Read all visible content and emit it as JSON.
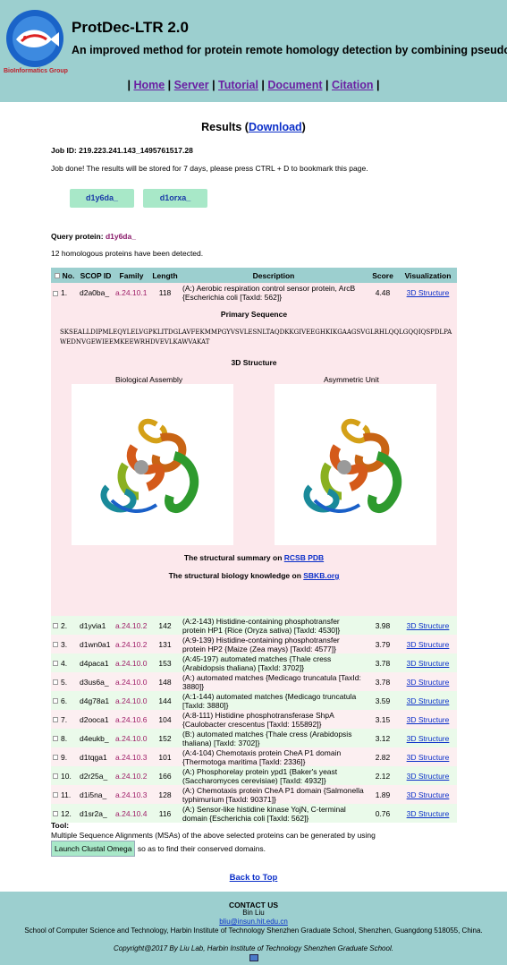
{
  "header": {
    "logo_text": "BioInformatics Group",
    "title": "ProtDec-LTR 2.0",
    "subtitle": "An improved method for protein remote homology detection by combining pseudo protein and supervised learning to rank",
    "nav": [
      "Home",
      "Server",
      "Tutorial",
      "Document",
      "Citation"
    ]
  },
  "results": {
    "title_prefix": "Results (",
    "download": "Download",
    "title_suffix": ")",
    "job_id": "Job ID: 219.223.241.143_1495761517.28",
    "job_msg": "Job done! The results will be stored for 7 days, please press CTRL + D to bookmark this page.",
    "chips": [
      "d1y6da_",
      "d1orxa_"
    ],
    "query_label": "Query protein: ",
    "query_value": "d1y6da_",
    "count_text": "12 homologous proteins have been detected."
  },
  "table": {
    "headers": [
      "No.",
      "SCOP ID",
      "Family",
      "Length",
      "Description",
      "Score",
      "Visualization"
    ],
    "rows": [
      {
        "no": "1.",
        "scop": "d2a0ba_",
        "family": "a.24.10.1",
        "length": "118",
        "desc": "(A:) Aerobic respiration control sensor protein, ArcB {Escherichia coli [TaxId: 562]}",
        "score": "4.48",
        "vis": "3D Structure"
      },
      {
        "no": "2.",
        "scop": "d1yvia1",
        "family": "a.24.10.2",
        "length": "142",
        "desc": "(A:2-143) Histidine-containing phosphotransfer protein HP1 {Rice (Oryza sativa) [TaxId: 4530]}",
        "score": "3.98",
        "vis": "3D Structure"
      },
      {
        "no": "3.",
        "scop": "d1wn0a1",
        "family": "a.24.10.2",
        "length": "131",
        "desc": "(A:9-139) Histidine-containing phosphotransfer protein HP2 {Maize (Zea mays) [TaxId: 4577]}",
        "score": "3.79",
        "vis": "3D Structure"
      },
      {
        "no": "4.",
        "scop": "d4paca1",
        "family": "a.24.10.0",
        "length": "153",
        "desc": "(A:45-197) automated matches {Thale cress (Arabidopsis thaliana) [TaxId: 3702]}",
        "score": "3.78",
        "vis": "3D Structure"
      },
      {
        "no": "5.",
        "scop": "d3us6a_",
        "family": "a.24.10.0",
        "length": "148",
        "desc": "(A:) automated matches {Medicago truncatula [TaxId: 3880]}",
        "score": "3.78",
        "vis": "3D Structure"
      },
      {
        "no": "6.",
        "scop": "d4g78a1",
        "family": "a.24.10.0",
        "length": "144",
        "desc": "(A:1-144) automated matches {Medicago truncatula [TaxId: 3880]}",
        "score": "3.59",
        "vis": "3D Structure"
      },
      {
        "no": "7.",
        "scop": "d2ooca1",
        "family": "a.24.10.6",
        "length": "104",
        "desc": "(A:8-111) Histidine phosphotransferase ShpA {Caulobacter crescentus [TaxId: 155892]}",
        "score": "3.15",
        "vis": "3D Structure"
      },
      {
        "no": "8.",
        "scop": "d4eukb_",
        "family": "a.24.10.0",
        "length": "152",
        "desc": "(B:) automated matches {Thale cress (Arabidopsis thaliana) [TaxId: 3702]}",
        "score": "3.12",
        "vis": "3D Structure"
      },
      {
        "no": "9.",
        "scop": "d1tqga1",
        "family": "a.24.10.3",
        "length": "101",
        "desc": "(A:4-104) Chemotaxis protein CheA P1 domain {Thermotoga maritima [TaxId: 2336]}",
        "score": "2.82",
        "vis": "3D Structure"
      },
      {
        "no": "10.",
        "scop": "d2r25a_",
        "family": "a.24.10.2",
        "length": "166",
        "desc": "(A:) Phosphorelay protein ypd1 {Baker's yeast (Saccharomyces cerevisiae) [TaxId: 4932]}",
        "score": "2.12",
        "vis": "3D Structure"
      },
      {
        "no": "11.",
        "scop": "d1i5na_",
        "family": "a.24.10.3",
        "length": "128",
        "desc": "(A:) Chemotaxis protein CheA P1 domain {Salmonella typhimurium [TaxId: 90371]}",
        "score": "1.89",
        "vis": "3D Structure"
      },
      {
        "no": "12.",
        "scop": "d1sr2a_",
        "family": "a.24.10.4",
        "length": "116",
        "desc": "(A:) Sensor-like histidine kinase YojN, C-terminal domain {Escherichia coli [TaxId: 562]}",
        "score": "0.76",
        "vis": "3D Structure"
      }
    ]
  },
  "detail": {
    "primary_title": "Primary Sequence",
    "sequence": "SKSEALLDIPMLEQYLELVGPKLITDGLAVFEKMMPGYVSVLESNLTAQDKKGIVEEGHKIKGAAGSVGLRHLQQLGQQIQSPDLPAWEDNVGEWIEEMKEEWRHDVEVLKAWVAKAT",
    "struct_title": "3D Structure",
    "bio_label": "Biological Assembly",
    "asym_label": "Asymmetric Unit",
    "summary_prefix": "The structural summary on ",
    "summary_link": "RCSB PDB",
    "knowledge_prefix": "The structural biology knowledge on ",
    "knowledge_link": "SBKB.org"
  },
  "tool": {
    "label": "Tool:",
    "text1": "Multiple Sequence Alignments (MSAs) of the above selected proteins can be generated by using",
    "button": "Launch Clustal Omega",
    "text2": " so as to find their conserved domains."
  },
  "back": "Back to Top",
  "footer": {
    "contact": "CONTACT US",
    "name": "Bin Liu",
    "email": "bliu@insun.hit.edu.cn",
    "address": "School of Computer Science and Technology, Harbin Institute of Technology Shenzhen Graduate School, Shenzhen, Guangdong 518055, China.",
    "copyright": "Copyright@2017 By Liu Lab, Harbin Institute of Technology Shenzhen Graduate School."
  },
  "colors": {
    "header_bg": "#9ccfcf",
    "chip_bg": "#a8e8c8",
    "link": "#0b2fc9",
    "nav_link": "#6a1fa2",
    "family": "#a0206a"
  }
}
